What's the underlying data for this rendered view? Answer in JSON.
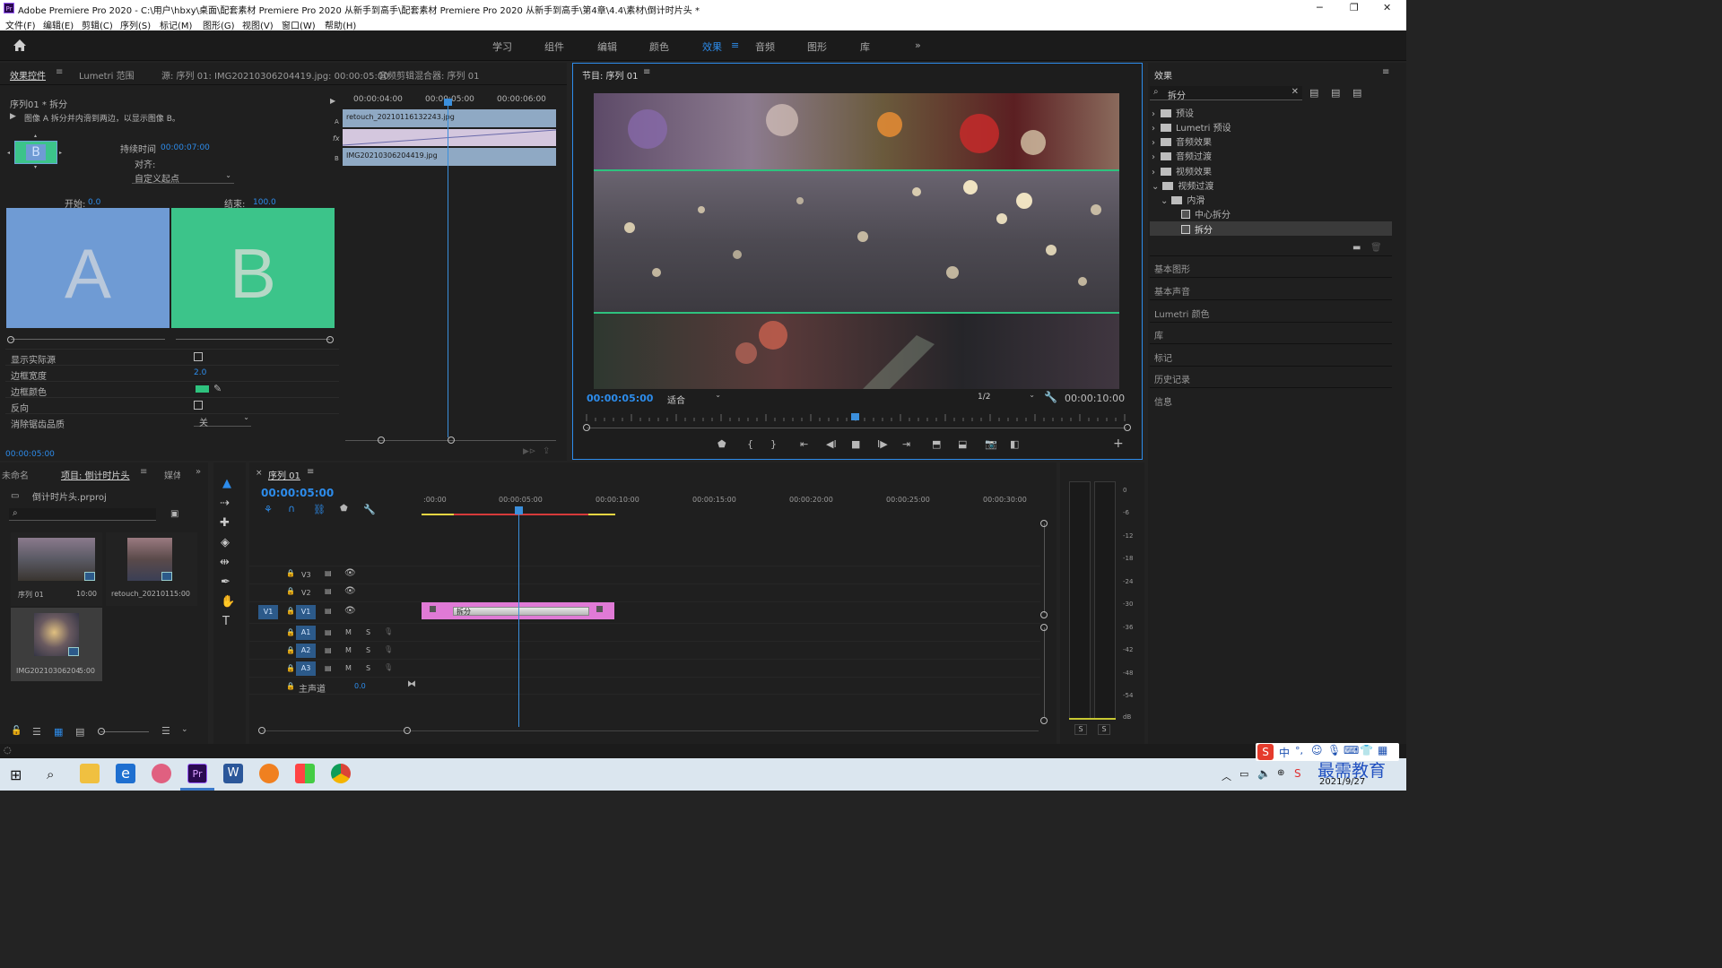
{
  "window": {
    "title": "Adobe Premiere Pro 2020 - C:\\用户\\hbxy\\桌面\\配套素材 Premiere Pro 2020 从新手到高手\\配套素材 Premiere Pro 2020 从新手到高手\\第4章\\4.4\\素材\\倒计时片头 *",
    "app_icon": "Pr"
  },
  "menu": [
    "文件(F)",
    "编辑(E)",
    "剪辑(C)",
    "序列(S)",
    "标记(M)",
    "图形(G)",
    "视图(V)",
    "窗口(W)",
    "帮助(H)"
  ],
  "workspaces": [
    "学习",
    "组件",
    "编辑",
    "颜色",
    "效果",
    "音频",
    "图形",
    "库"
  ],
  "workspace_more": "»",
  "effect_controls": {
    "tabs": [
      "效果控件",
      "Lumetri 范围",
      "源: 序列 01: IMG20210306204419.jpg: 00:00:05:00",
      "音频剪辑混合器: 序列 01"
    ],
    "clip": "序列01 * 拆分",
    "description": "图像 A 拆分并内滑到两边，以显示图像 B。",
    "duration_label": "持续时间",
    "duration": "00:00:07:00",
    "align_label": "对齐:",
    "align_value": "自定义起点",
    "start_label": "开始:",
    "start_value": "0.0",
    "end_label": "结束:",
    "end_value": "100.0",
    "a_letter": "A",
    "b_letter": "B",
    "ruler": [
      "00:00:04:00",
      "00:00:05:00",
      "00:00:06:00"
    ],
    "clip_a": "retouch_20210116132243.jpg",
    "clip_b": "IMG20210306204419.jpg",
    "track_letters": [
      "A",
      "fx",
      "B"
    ],
    "props": [
      {
        "label": "显示实际源",
        "value": ""
      },
      {
        "label": "边框宽度",
        "value": "2.0"
      },
      {
        "label": "边框颜色",
        "value": ""
      },
      {
        "label": "反向",
        "value": ""
      },
      {
        "label": "消除锯齿品质",
        "value": "关"
      }
    ],
    "border_color": "#2ec27e",
    "timecode": "00:00:05:00"
  },
  "program": {
    "title": "节目: 序列 01",
    "timecode": "00:00:05:00",
    "fit": "适合",
    "resolution": "1/2",
    "duration": "00:00:10:00",
    "split_line_color": "#2ec27e"
  },
  "effects": {
    "title": "效果",
    "search": "拆分",
    "tree": [
      {
        "label": "预设",
        "level": 0,
        "type": "folder"
      },
      {
        "label": "Lumetri 预设",
        "level": 0,
        "type": "folder"
      },
      {
        "label": "音频效果",
        "level": 0,
        "type": "folder"
      },
      {
        "label": "音频过渡",
        "level": 0,
        "type": "folder"
      },
      {
        "label": "视频效果",
        "level": 0,
        "type": "folder"
      },
      {
        "label": "视频过渡",
        "level": 0,
        "type": "folder",
        "open": true
      },
      {
        "label": "内滑",
        "level": 1,
        "type": "folder",
        "open": true
      },
      {
        "label": "中心拆分",
        "level": 2,
        "type": "fx"
      },
      {
        "label": "拆分",
        "level": 2,
        "type": "fx",
        "selected": true
      }
    ],
    "sections": [
      "基本图形",
      "基本声音",
      "Lumetri 颜色",
      "库",
      "标记",
      "历史记录",
      "信息"
    ]
  },
  "project": {
    "tabs": [
      "未命名",
      "项目: 倒计时片头",
      "媒体"
    ],
    "file": "倒计时片头.prproj",
    "items": [
      {
        "name": "序列 01",
        "duration": "10:00"
      },
      {
        "name": "retouch_20210116...",
        "duration": "5:00"
      },
      {
        "name": "IMG20210306204...",
        "duration": "5:00"
      }
    ]
  },
  "timeline": {
    "tab": "序列 01",
    "timecode": "00:00:05:00",
    "ruler": [
      ":00:00",
      "00:00:05:00",
      "00:00:10:00",
      "00:00:15:00",
      "00:00:20:00",
      "00:00:25:00",
      "00:00:30:00"
    ],
    "tracks": [
      {
        "name": "V3",
        "kind": "video"
      },
      {
        "name": "V2",
        "kind": "video"
      },
      {
        "name": "V1",
        "kind": "video",
        "source": "V1"
      },
      {
        "name": "A1",
        "kind": "audio"
      },
      {
        "name": "A2",
        "kind": "audio"
      },
      {
        "name": "A3",
        "kind": "audio"
      }
    ],
    "master_label": "主声道",
    "master_value": "0.0",
    "transition_label": "拆分",
    "clip_color": "#e07ad6",
    "ms": [
      "M",
      "S"
    ]
  },
  "meter": {
    "scale": [
      "0",
      "-6",
      "-12",
      "-18",
      "-24",
      "-30",
      "-36",
      "-42",
      "-48",
      "-54",
      "dB"
    ],
    "solo": [
      "S",
      "S"
    ]
  },
  "taskbar": {
    "date": "2021/9/27",
    "watermark": "最需教育",
    "ime": "中"
  }
}
